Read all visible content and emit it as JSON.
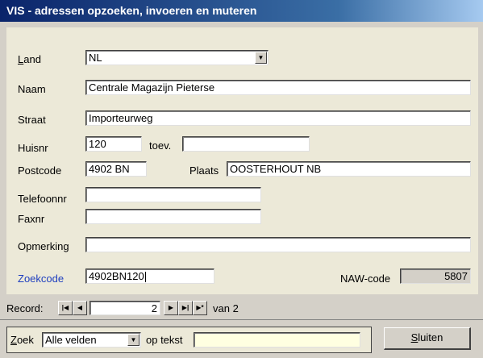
{
  "window": {
    "title": "VIS -  adressen opzoeken, invoeren en muteren"
  },
  "form": {
    "land_label": "Land",
    "land_value": "NL",
    "naam_label": "Naam",
    "naam_value": "Centrale Magazijn Pieterse",
    "straat_label": "Straat",
    "straat_value": "Importeurweg",
    "huisnr_label": "Huisnr",
    "huisnr_value": "120",
    "toev_label": "toev.",
    "toev_value": "",
    "postcode_label": "Postcode",
    "postcode_value": "4902 BN",
    "plaats_label": "Plaats",
    "plaats_value": "OOSTERHOUT NB",
    "telefoon_label": "Telefoonnr",
    "telefoon_value": "",
    "fax_label": "Faxnr",
    "fax_value": "",
    "opmerking_label": "Opmerking",
    "opmerking_value": "",
    "zoekcode_label": "Zoekcode",
    "zoekcode_value": "4902BN120",
    "naw_label": "NAW-code",
    "naw_value": "5807",
    "link_color": "#1f3fbf"
  },
  "navigation": {
    "record_label": "Record:",
    "record_value": "2",
    "of_label": "van 2",
    "first_icon": "first-record-icon",
    "prev_icon": "previous-record-icon",
    "next_icon": "next-record-icon",
    "last_icon": "last-record-icon",
    "new_icon": "new-record-icon"
  },
  "search": {
    "zoek_label": "Zoek",
    "field_value": "Alle velden",
    "op_tekst_label": "op tekst",
    "text_value": "",
    "close_label": "Sluiten",
    "search_bg": "#ffffe1"
  }
}
